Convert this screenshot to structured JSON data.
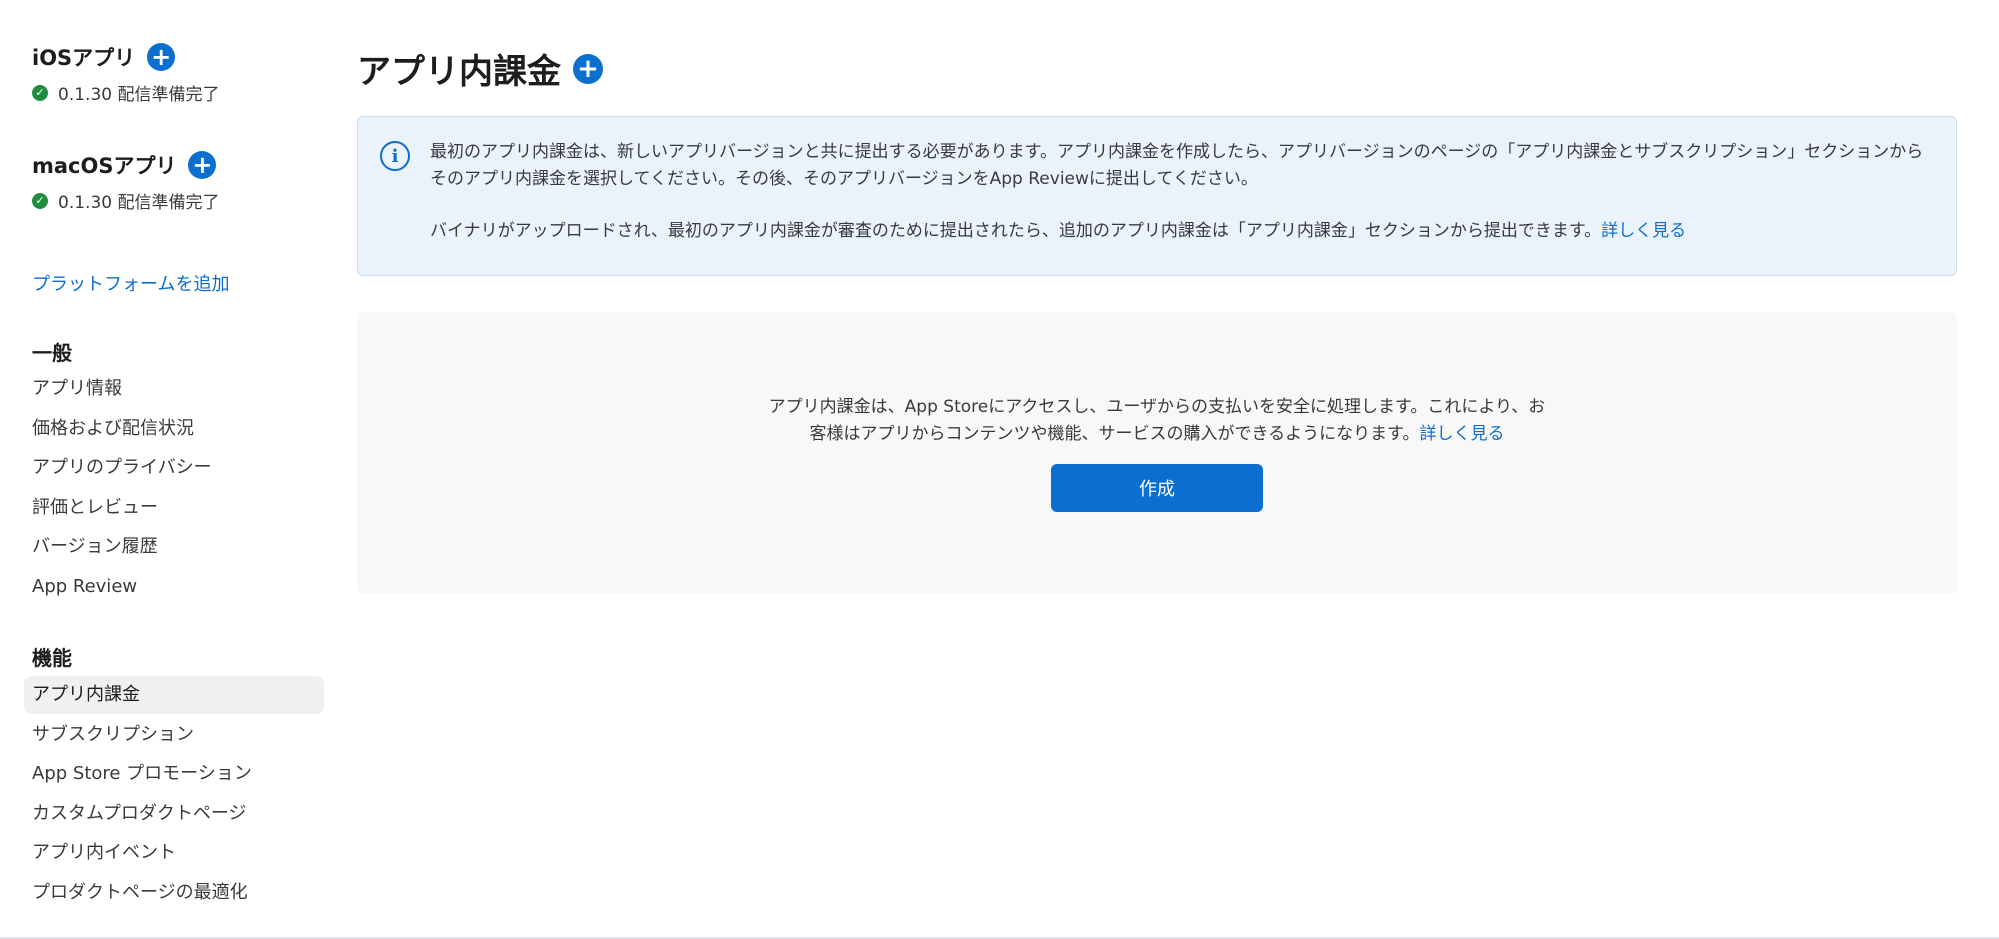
{
  "sidebar": {
    "platforms": [
      {
        "name": "iOSアプリ",
        "status": "0.1.30 配信準備完了"
      },
      {
        "name": "macOSアプリ",
        "status": "0.1.30 配信準備完了"
      }
    ],
    "add_platform": "プラットフォームを追加",
    "sections": [
      {
        "heading": "一般",
        "items": [
          "アプリ情報",
          "価格および配信状況",
          "アプリのプライバシー",
          "評価とレビュー",
          "バージョン履歴",
          "App Review"
        ]
      },
      {
        "heading": "機能",
        "items": [
          "アプリ内課金",
          "サブスクリプション",
          "App Store プロモーション",
          "カスタムプロダクトページ",
          "アプリ内イベント",
          "プロダクトページの最適化"
        ]
      }
    ],
    "active_item": "アプリ内課金"
  },
  "main": {
    "title": "アプリ内課金",
    "info": {
      "paragraph1": "最初のアプリ内課金は、新しいアプリバージョンと共に提出する必要があります。アプリ内課金を作成したら、アプリバージョンのページの「アプリ内課金とサブスクリプション」セクションからそのアプリ内課金を選択してください。その後、そのアプリバージョンをApp Reviewに提出してください。",
      "paragraph2": "バイナリがアップロードされ、最初のアプリ内課金が審査のために提出されたら、追加のアプリ内課金は「アプリ内課金」セクションから提出できます。",
      "link": "詳しく見る"
    },
    "empty": {
      "line1": "アプリ内課金は、App Storeにアクセスし、ユーザからの支払いを安全に処理します。これにより、お",
      "line2": "客様はアプリからコンテンツや機能、サービスの購入ができるようになります。",
      "link": "詳しく見る",
      "button": "作成"
    }
  },
  "icons": {
    "add": "plus-circle-icon",
    "status": "check-circle-icon",
    "info": "info-circle-icon"
  },
  "colors": {
    "accent": "#0a6fcf",
    "success": "#1e8e3e",
    "info_bg": "#eaf3fc"
  }
}
